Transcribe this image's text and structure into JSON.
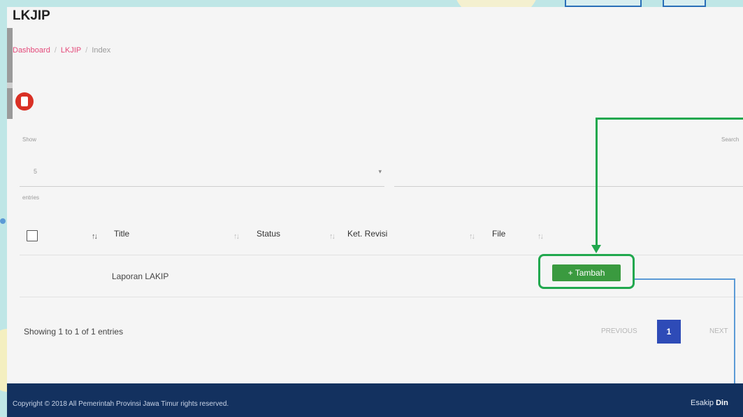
{
  "page_title": "LKJIP",
  "breadcrumb": [
    "Dashboard",
    "LKJIP",
    "Index"
  ],
  "show_label": "Show",
  "entries_value": "5",
  "entries_label": "entries",
  "search_label": "Search",
  "columns": [
    "Title",
    "Status",
    "Ket. Revisi",
    "File"
  ],
  "rows": [
    {
      "title": "Laporan LAKIP",
      "status": "",
      "ket_revisi": "",
      "file": ""
    }
  ],
  "add_button_label": "+ Tambah",
  "info": "Showing 1 to 1 of 1 entries",
  "pagination": {
    "previous": "PREVIOUS",
    "current": "1",
    "next": "NEXT"
  },
  "footer": {
    "copyright": "Copyright © 2018 All Pemerintah Provinsi Jawa Timur rights reserved.",
    "brand_prefix": "Esakip",
    "brand_bold": "Din"
  },
  "colors": {
    "accent_pink": "#e44a7a",
    "add_green": "#3a9a3f",
    "highlight_green": "#21a84e",
    "pager_blue": "#2e4bb7",
    "footer_navy": "#13315f",
    "delete_red": "#d93025"
  }
}
